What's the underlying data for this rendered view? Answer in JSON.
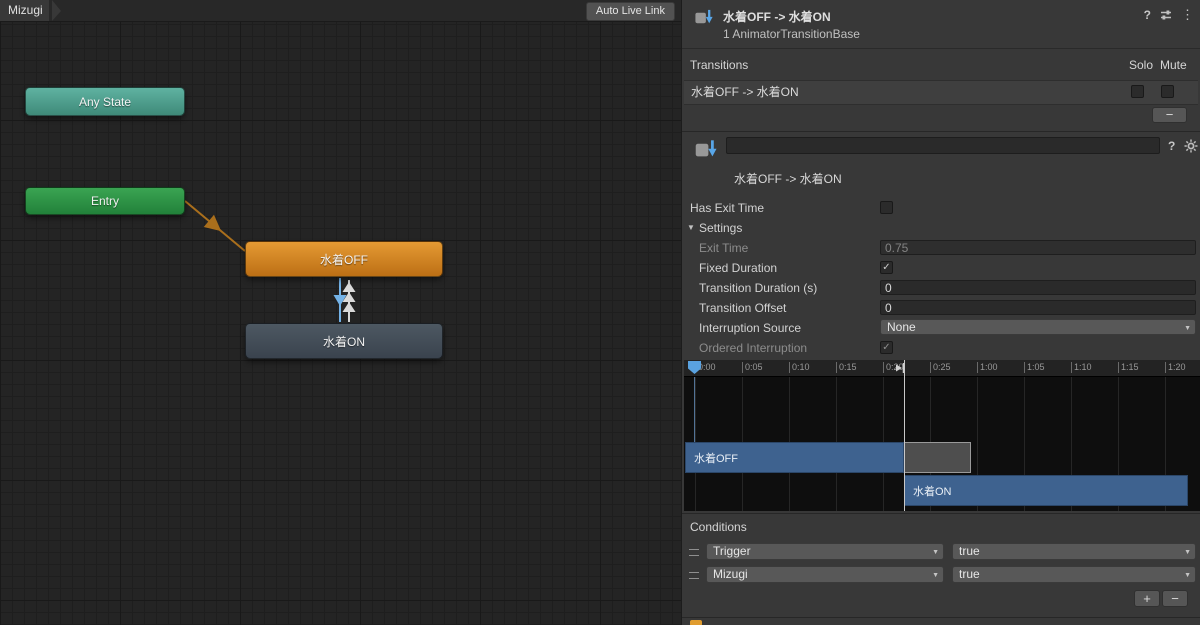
{
  "colors": {
    "any_state_node": "#4aa08c",
    "entry_node": "#2f9e44",
    "default_state_node": "#d9862a",
    "state_node": "#465059",
    "selected_transition": "#74b3e8",
    "timeline_bar": "#3e628f"
  },
  "graph": {
    "tab_label": "Mizugi",
    "auto_live_link_label": "Auto Live Link",
    "nodes": {
      "any_state": "Any State",
      "entry": "Entry",
      "state_off": "水着OFF",
      "state_on": "水着ON"
    }
  },
  "inspector": {
    "header": {
      "title": "水着OFF -> 水着ON",
      "subtitle": "1 AnimatorTransitionBase"
    },
    "transitions": {
      "title": "Transitions",
      "solo": "Solo",
      "mute": "Mute",
      "rows": [
        {
          "label": "水着OFF -> 水着ON",
          "solo": false,
          "mute": false
        }
      ],
      "remove": "−"
    },
    "detail": {
      "name_value": "",
      "title": "水着OFF -> 水着ON",
      "has_exit_time": {
        "label": "Has Exit Time",
        "checked": false
      },
      "settings": {
        "label": "Settings"
      },
      "exit_time": {
        "label": "Exit Time",
        "value": "0.75"
      },
      "fixed_duration": {
        "label": "Fixed Duration",
        "checked": true
      },
      "transition_duration": {
        "label": "Transition Duration (s)",
        "value": "0"
      },
      "transition_offset": {
        "label": "Transition Offset",
        "value": "0"
      },
      "interruption_source": {
        "label": "Interruption Source",
        "value": "None"
      },
      "ordered_interruption": {
        "label": "Ordered Interruption",
        "checked": true
      }
    },
    "timeline": {
      "ticks": [
        "0:00",
        "0:05",
        "0:10",
        "0:15",
        "0:20",
        "0:25",
        "1:00",
        "1:05",
        "1:10",
        "1:15",
        "1:20"
      ],
      "bars": [
        {
          "label": "水着OFF"
        },
        {
          "label": "水着ON"
        }
      ]
    },
    "conditions": {
      "title": "Conditions",
      "rows": [
        {
          "parameter": "Trigger",
          "value": "true"
        },
        {
          "parameter": "Mizugi",
          "value": "true"
        }
      ],
      "add": "+",
      "remove": "−"
    }
  }
}
